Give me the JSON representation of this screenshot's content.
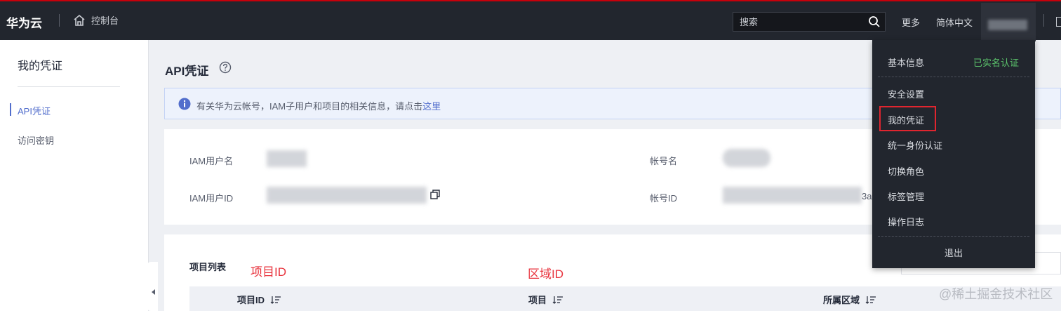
{
  "topbar": {
    "brand": "华为云",
    "console": "控制台",
    "search_placeholder": "搜索",
    "more": "更多",
    "language": "简体中文"
  },
  "sidebar": {
    "title": "我的凭证",
    "items": [
      {
        "label": "API凭证",
        "active": true
      },
      {
        "label": "访问密钥",
        "active": false
      }
    ]
  },
  "main": {
    "title": "API凭证",
    "info_text": "有关华为云帐号，IAM子用户和项目的相关信息，请点击",
    "info_link": "这里",
    "fields": {
      "iam_user_name_label": "IAM用户名",
      "iam_user_id_label": "IAM用户ID",
      "account_name_label": "帐号名",
      "account_id_label": "帐号ID",
      "account_id_tail": "3a"
    },
    "project_list_title": "项目列表",
    "annotation_project_id": "项目ID",
    "annotation_region_id": "区域ID",
    "table_headers": [
      "项目ID",
      "项目",
      "所属区域"
    ]
  },
  "dropdown": {
    "basic_info": "基本信息",
    "verified": "已实名认证",
    "items": [
      "安全设置",
      "我的凭证",
      "统一身份认证",
      "切换角色",
      "标签管理",
      "操作日志"
    ],
    "logout": "退出"
  },
  "watermark": "@稀土掘金技术社区",
  "colors": {
    "topbar_bg": "#22262e",
    "accent_blue": "#526ecc",
    "verified_green": "#5cc46c",
    "highlight_red": "#e0252f"
  }
}
